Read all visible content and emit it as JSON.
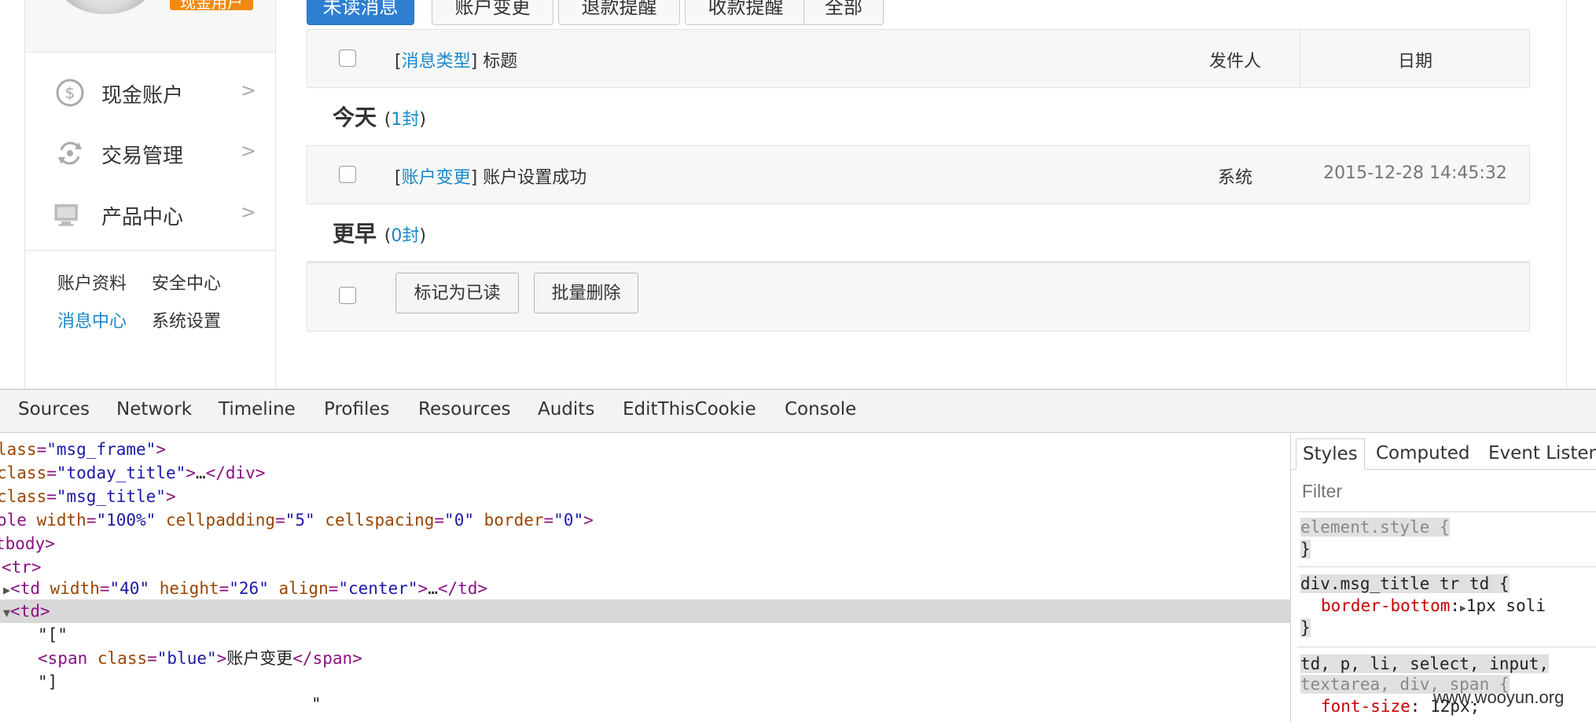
{
  "sidebar": {
    "user_tag": "现金用户",
    "nav": [
      {
        "icon": "dollar-circle-icon",
        "label": "现金账户",
        "arrow": ">"
      },
      {
        "icon": "exchange-icon",
        "label": "交易管理",
        "arrow": ">"
      },
      {
        "icon": "monitor-icon",
        "label": "产品中心",
        "arrow": ">"
      }
    ],
    "links": {
      "account_info": "账户资料",
      "security_center": "安全中心",
      "message_center": "消息中心",
      "system_settings": "系统设置"
    }
  },
  "tabs": [
    "未读消息",
    "账户变更",
    "退款提醒",
    "收款提醒",
    "全部"
  ],
  "table_header": {
    "type_label": "消息类型",
    "title_label": "标题",
    "sender": "发件人",
    "date": "日期"
  },
  "sections": {
    "today": {
      "title": "今天",
      "count": "1封"
    },
    "earlier": {
      "title": "更早",
      "count": "0封"
    }
  },
  "message": {
    "type": "账户变更",
    "title": "账户设置成功",
    "sender": "系统",
    "date": "2015-12-28 14:45:32"
  },
  "actions": {
    "mark_read": "标记为已读",
    "batch_delete": "批量删除"
  },
  "devtools": {
    "tabs": [
      "Sources",
      "Network",
      "Timeline",
      "Profiles",
      "Resources",
      "Audits",
      "EditThisCookie",
      "Console"
    ],
    "styles_tabs": [
      "Styles",
      "Computed",
      "Event Listen"
    ],
    "filter_placeholder": "Filter",
    "code": {
      "l0_attr": "lass",
      "l0_val": "\"msg_frame\"",
      "l1_attr": "class",
      "l1_val": "\"today_title\"",
      "l1_ellipsis": "…",
      "l1_close": "</div>",
      "l2_attr": "class",
      "l2_val": "\"msg_title\"",
      "l3_tag": "ole",
      "l3_a1": "width",
      "l3_v1": "\"100%\"",
      "l3_a2": "cellpadding",
      "l3_v2": "\"5\"",
      "l3_a3": "cellspacing",
      "l3_v3": "\"0\"",
      "l3_a4": "border",
      "l3_v4": "\"0\"",
      "l4_tag": "tbody",
      "l5_tag": "<tr>",
      "l6_tag": "td",
      "l6_a1": "width",
      "l6_v1": "\"40\"",
      "l6_a2": "height",
      "l6_v2": "\"26\"",
      "l6_a3": "align",
      "l6_v3": "\"center\"",
      "l6_ellipsis": "…",
      "l6_close": "</td>",
      "l7_tag": "<td>",
      "l8_text": "\"[\"",
      "l9_tag": "span",
      "l9_a1": "class",
      "l9_v1": "\"blue\"",
      "l9_text": "账户变更",
      "l9_close": "</span>",
      "l10_text": "\"]",
      "l11_text": "\""
    },
    "css": {
      "r1_selector": "element.style {",
      "r1_close": "}",
      "r2_selector": "div.msg_title tr td {",
      "r2_prop": "border-bottom",
      "r2_val": "1px soli",
      "r2_close": "}",
      "r3_selector": "td, p, li, select, input,",
      "r3_selector2": "textarea, div, span {",
      "r3_prop": "font-size",
      "r3_val": "12px;"
    }
  },
  "watermark": "www.wooyun.org"
}
